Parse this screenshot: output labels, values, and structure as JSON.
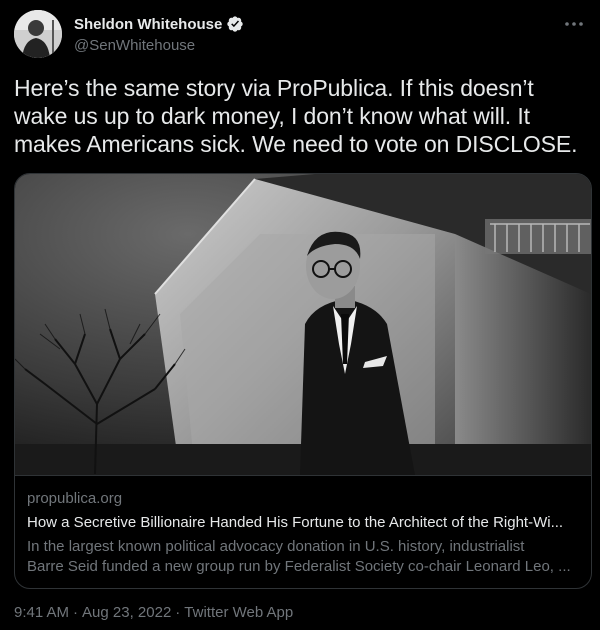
{
  "author": {
    "display_name": "Sheldon Whitehouse",
    "handle": "@SenWhitehouse",
    "verified": true
  },
  "icons": {
    "verified": "verified-badge-icon",
    "more": "more-options-icon"
  },
  "tweet": {
    "text": "Here’s the same story via ProPublica. If this doesn’t wake us up to dark money, I don’t know what will. It makes Americans sick. We need to vote on DISCLOSE."
  },
  "card": {
    "domain": "propublica.org",
    "title": "How a Secretive Billionaire Handed His Fortune to the Architect of the Right-Wi...",
    "description_line1": "In the largest known political advocacy donation in U.S. history, industrialist",
    "description_line2": "Barre Seid funded a new group run by Federalist Society co-chair Leonard Leo, ..."
  },
  "meta": {
    "time": "9:41 AM",
    "separator": "·",
    "date": "Aug 23, 2022",
    "source": "Twitter Web App"
  },
  "colors": {
    "background": "#000000",
    "primary_text": "#e7e9ea",
    "secondary_text": "#71767b",
    "verified_blue": "#1d9bf0",
    "border": "#2f3336"
  }
}
